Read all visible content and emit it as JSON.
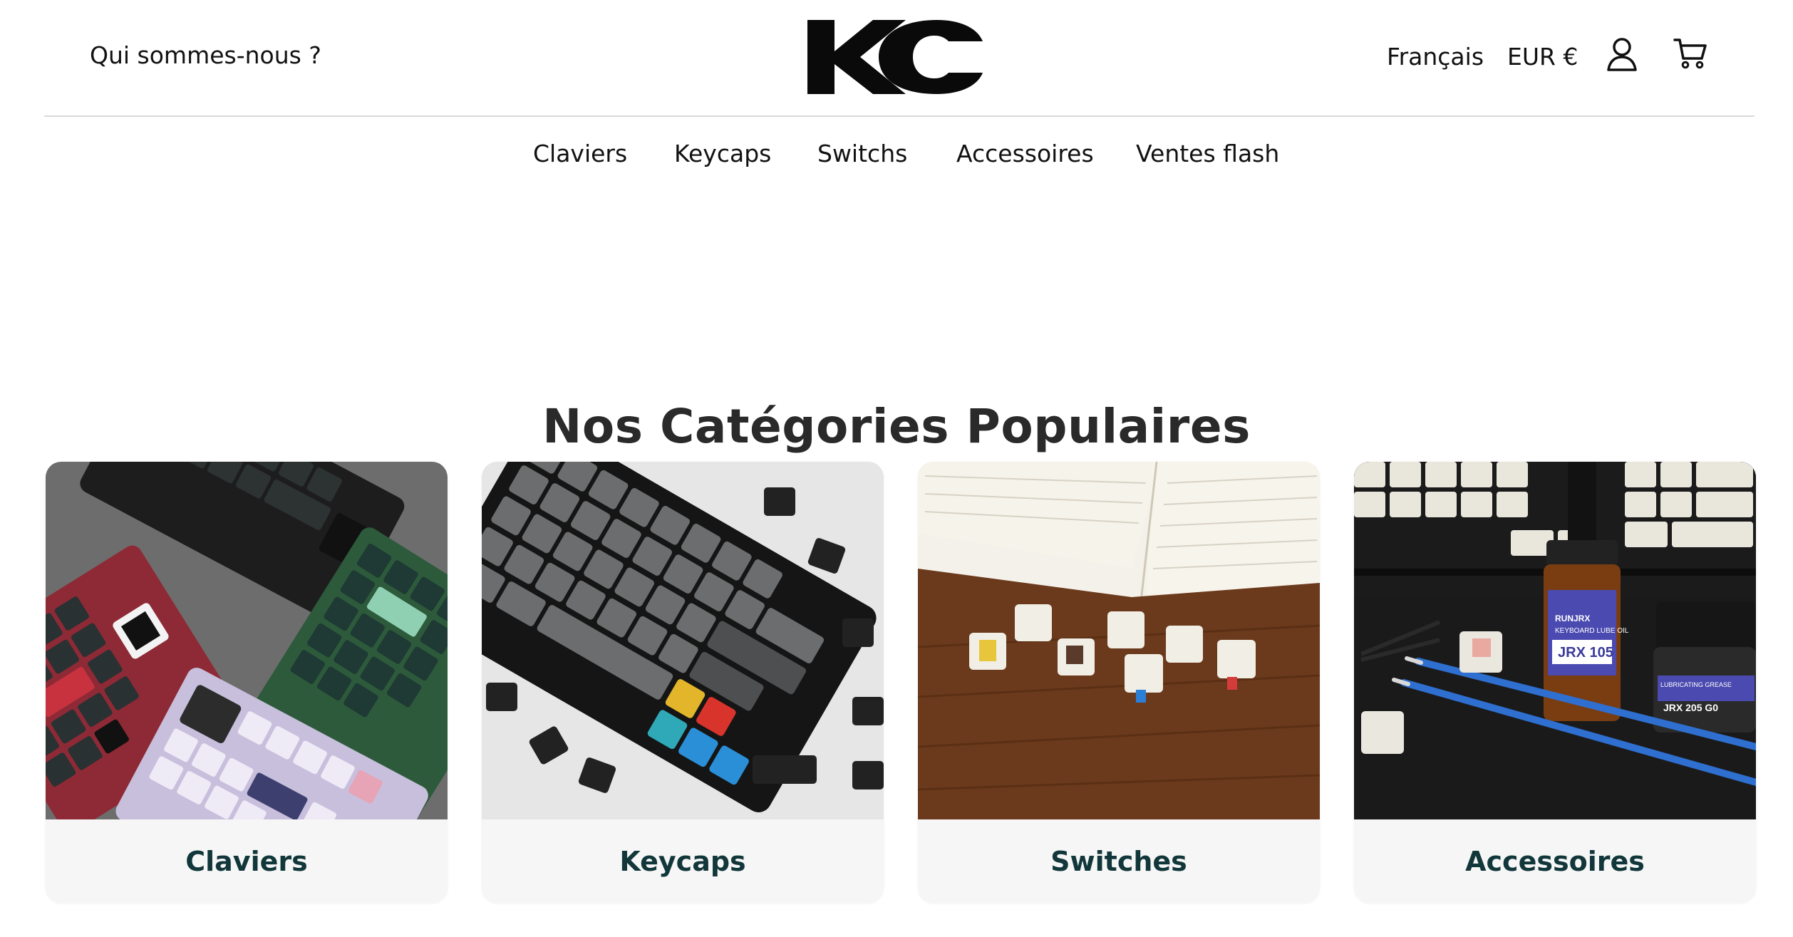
{
  "header": {
    "about_label": "Qui sommes-nous ?",
    "logo_text": "KC",
    "language_label": "Français",
    "currency_label": "EUR €",
    "account_icon": "user-icon",
    "cart_icon": "cart-icon"
  },
  "nav": {
    "items": [
      {
        "label": "Claviers"
      },
      {
        "label": "Keycaps"
      },
      {
        "label": "Switchs"
      },
      {
        "label": "Accessoires"
      },
      {
        "label": "Ventes flash"
      }
    ]
  },
  "categories_section": {
    "title": "Nos Catégories Populaires",
    "cards": [
      {
        "label": "Claviers",
        "image": "keyboards-photo"
      },
      {
        "label": "Keycaps",
        "image": "keycaps-photo"
      },
      {
        "label": "Switches",
        "image": "switches-photo"
      },
      {
        "label": "Accessoires",
        "image": "accessories-photo"
      }
    ]
  },
  "photo_text": {
    "lube_brand": "RUNJRX",
    "lube_name": "KEYBOARD LUBE OIL",
    "lube_model": "JRX 105",
    "grease_name": "LUBRICATING GREASE",
    "grease_model": "JRX 205 G0"
  },
  "colors": {
    "label_text": "#12373a",
    "card_bg": "#f6f6f6",
    "divider": "#d9d9d9"
  }
}
